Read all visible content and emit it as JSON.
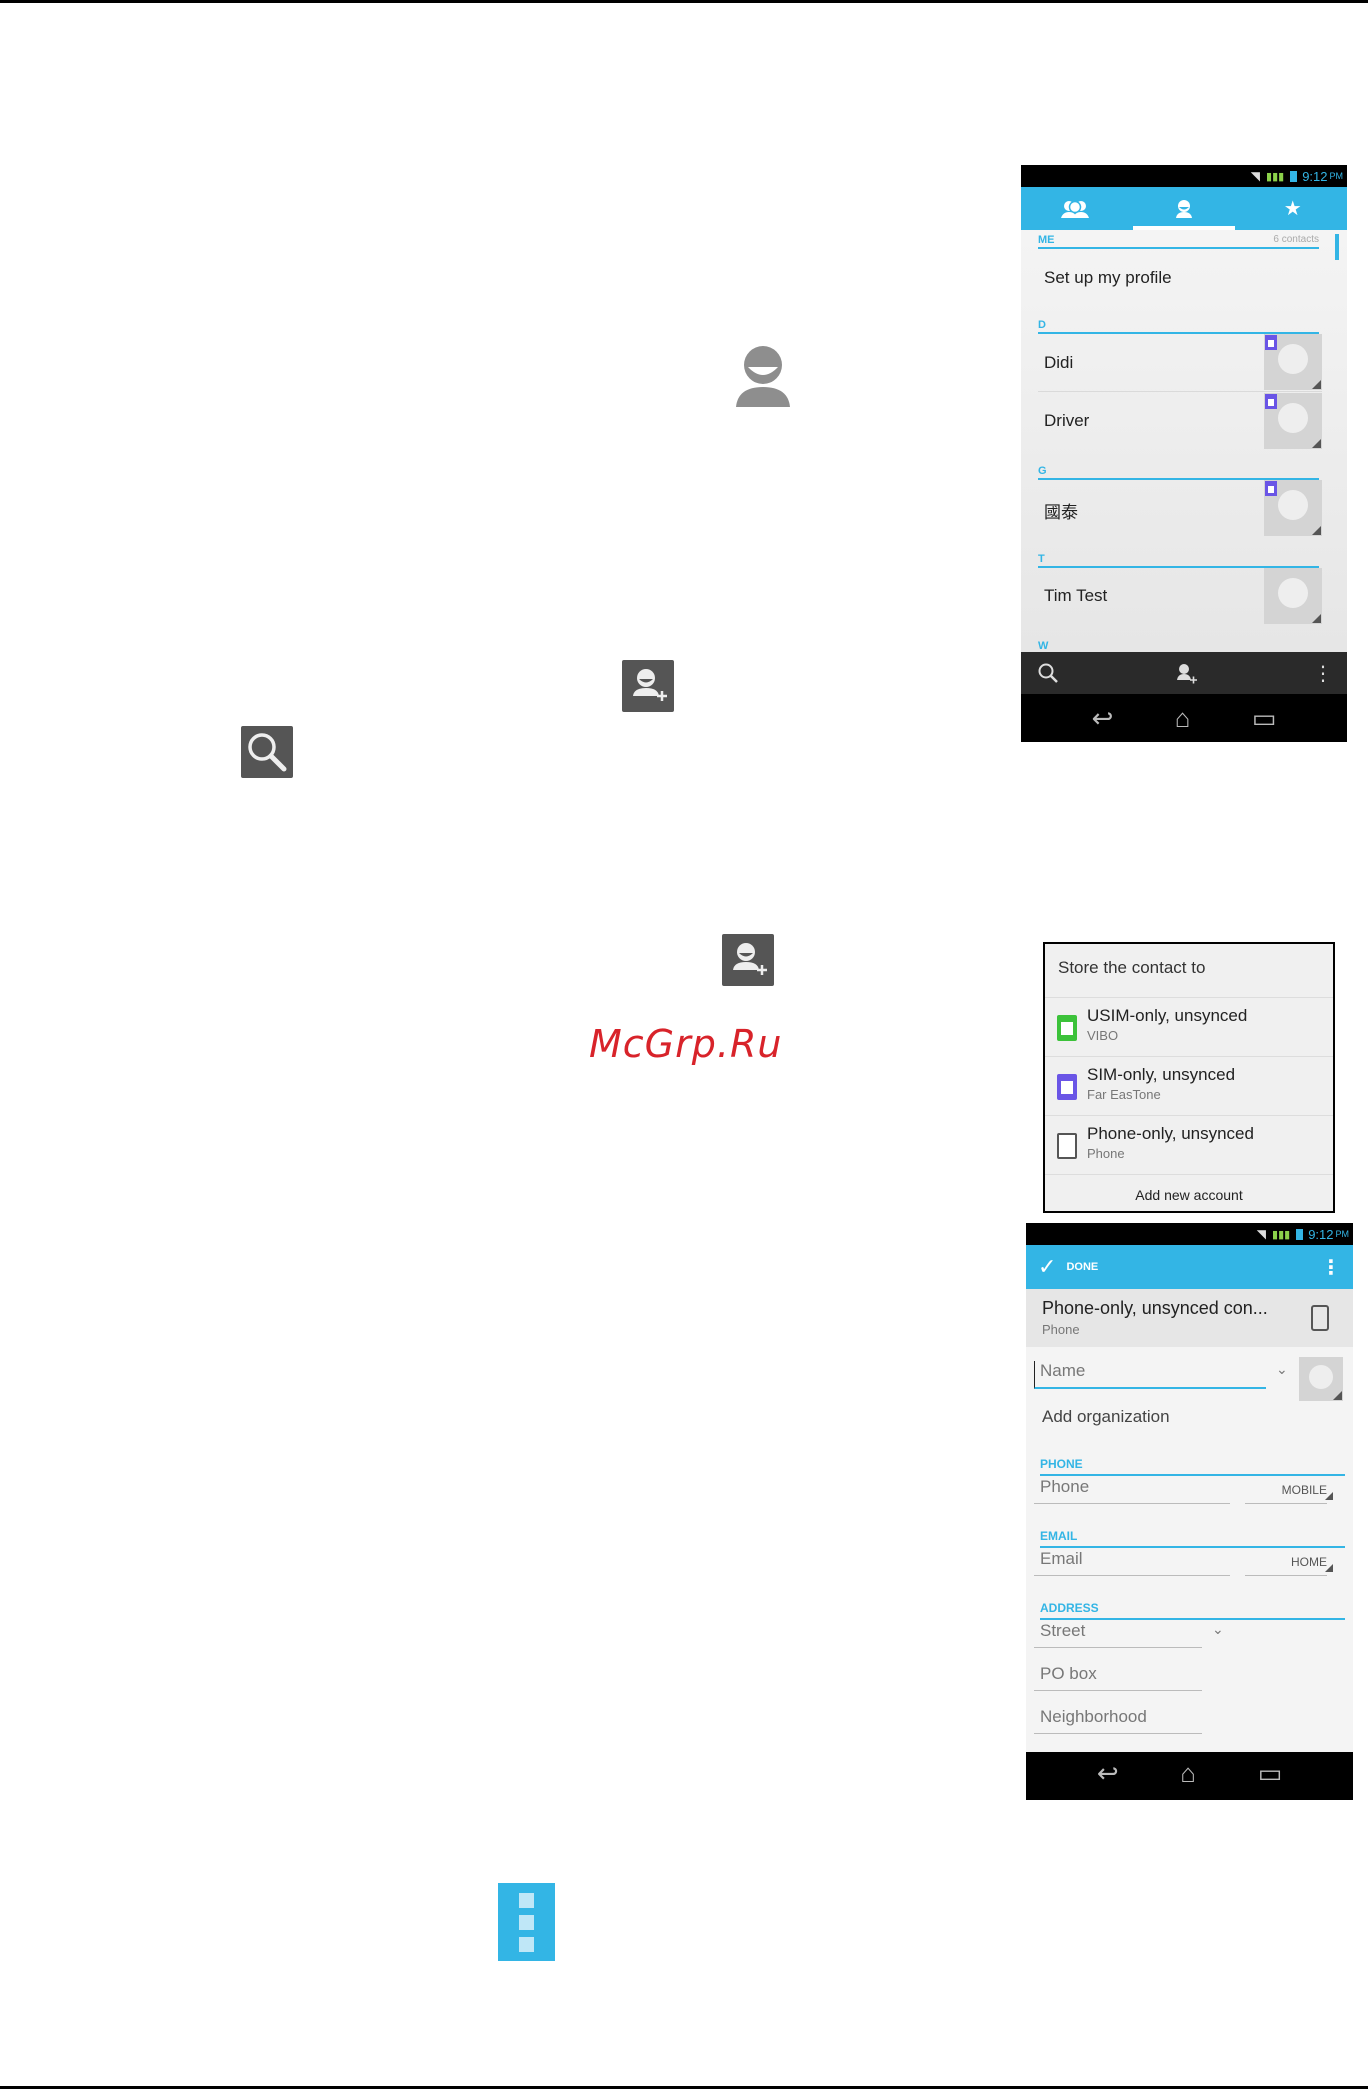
{
  "watermark": "McGrp.Ru",
  "icons": {
    "contact": "contact-icon",
    "add_contact": "add-contact-icon",
    "search": "search-icon",
    "menu": "menu-icon"
  },
  "phone1": {
    "status_time": "9:12",
    "status_ampm": "PM",
    "sections": {
      "me": "ME",
      "me_count": "6 contacts",
      "d": "D",
      "g": "G",
      "t": "T",
      "w": "W"
    },
    "profile": "Set up my profile",
    "contacts": [
      "Didi",
      "Driver",
      "國泰",
      "Tim Test"
    ]
  },
  "dialog": {
    "title": "Store the contact to",
    "options": [
      {
        "label": "USIM-only, unsynced",
        "sub": "VIBO",
        "color": "#3cc23a"
      },
      {
        "label": "SIM-only, unsynced",
        "sub": "Far EasTone",
        "color": "#6a55e6"
      },
      {
        "label": "Phone-only, unsynced",
        "sub": "Phone",
        "color": "#555555"
      }
    ],
    "add_account": "Add new account"
  },
  "phone2": {
    "status_time": "9:12",
    "status_ampm": "PM",
    "done": "DONE",
    "account_title": "Phone-only, unsynced con...",
    "account_sub": "Phone",
    "name_placeholder": "Name",
    "add_org": "Add organization",
    "phone_section": "PHONE",
    "phone_placeholder": "Phone",
    "phone_type": "MOBILE",
    "email_section": "EMAIL",
    "email_placeholder": "Email",
    "email_type": "HOME",
    "address_section": "ADDRESS",
    "street": "Street",
    "pobox": "PO box",
    "neighborhood": "Neighborhood"
  },
  "colors": {
    "accent": "#33b5e5",
    "watermark": "#d8232a"
  }
}
